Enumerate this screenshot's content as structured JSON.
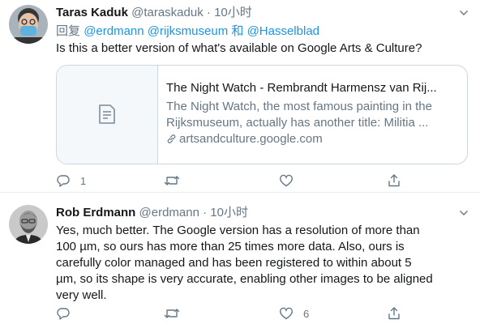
{
  "tweets": [
    {
      "name": "Taras Kaduk",
      "handle": "@taraskaduk",
      "dot": "·",
      "time": "10小时",
      "reply_prefix": "回复",
      "mentions": [
        "@erdmann",
        "@rijksmuseum"
      ],
      "mention_conj": "和",
      "mention_last": "@Hasselblad",
      "text": "Is this a better version of what's available on Google Arts & Culture?",
      "card": {
        "title": "The Night Watch - Rembrandt Harmensz van Rij...",
        "desc_lines": [
          "The Night Watch, the most famous painting in the",
          "Rijksmuseum, actually has another title: Militia ..."
        ],
        "link": "artsandculture.google.com",
        "icon": "document-icon"
      },
      "actions": {
        "reply_count": "1",
        "retweet_count": "",
        "like_count": ""
      }
    },
    {
      "name": "Rob Erdmann",
      "handle": "@erdmann",
      "dot": "·",
      "time": "10小时",
      "text_lines": [
        "Yes, much better.  The Google version has a resolution of more than",
        "100 µm, so ours has more than 25 times more data.  Also, ours is",
        "carefully color managed and has been registered to within about 5",
        "µm, so its shape is very accurate, enabling other images to be aligned",
        "very well."
      ],
      "actions": {
        "reply_count": "",
        "retweet_count": "",
        "like_count": "6"
      }
    }
  ],
  "colors": {
    "accent": "#1b95e0",
    "secondary_text": "#657786",
    "border": "#ccd6dd"
  }
}
